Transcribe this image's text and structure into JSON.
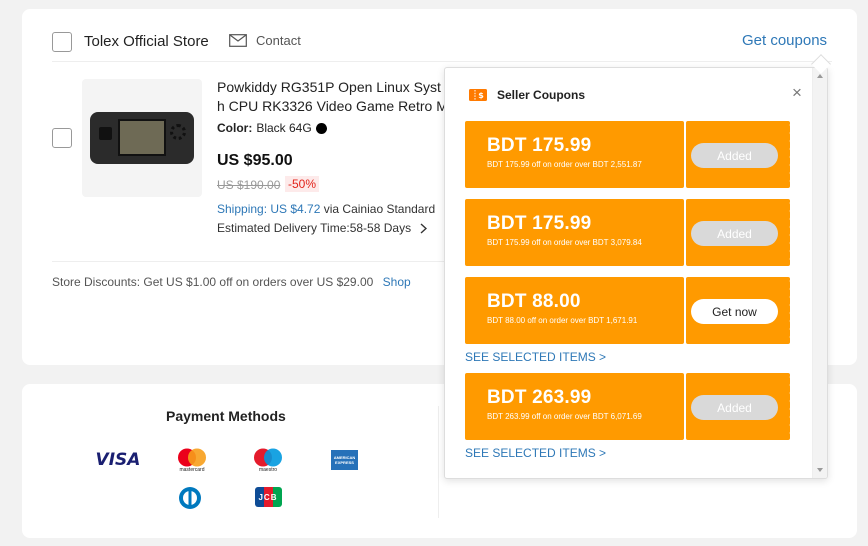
{
  "store": {
    "name": "Tolex Official Store",
    "contact_label": "Contact",
    "get_coupons_label": "Get coupons"
  },
  "product": {
    "title_line1": "Powkiddy RG351P Open Linux Syst",
    "title_line2": "h CPU RK3326 Video Game Retro M",
    "color_label": "Color:",
    "color_value": "Black 64G",
    "price": "US $95.00",
    "old_price": "US $190.00",
    "discount": "-50%",
    "shipping_label": "Shipping: US $4.72",
    "shipping_via": "via Cainiao Standard",
    "delivery": "Estimated Delivery Time:58-58 Days"
  },
  "store_discount": {
    "text": "Store Discounts:  Get US $1.00 off on orders over US $29.00",
    "shop_label": "Shop"
  },
  "payment": {
    "title": "Payment Methods",
    "visa_label": "VISA",
    "mastercard_label": "mastercard",
    "maestro_label": "maestro",
    "amex_label": "AMERICAN EXPRESS",
    "jcb_label": "JCB"
  },
  "coupons_popover": {
    "title": "Seller Coupons",
    "close": "×",
    "coupons": [
      {
        "amount": "BDT 175.99",
        "desc": "BDT 175.99 off on order over BDT 2,551.87",
        "button": "Added",
        "state": "added"
      },
      {
        "amount": "BDT 175.99",
        "desc": "BDT 175.99 off on order over BDT 3,079.84",
        "button": "Added",
        "state": "added"
      },
      {
        "amount": "BDT 88.00",
        "desc": "BDT 88.00 off on order over BDT 1,671.91",
        "button": "Get now",
        "state": "available"
      },
      {
        "amount": "BDT 263.99",
        "desc": "BDT 263.99 off on order over BDT 6,071.69",
        "button": "Added",
        "state": "added"
      }
    ],
    "see_selected_label": "SEE SELECTED ITEMS >"
  },
  "colors": {
    "coupon_orange": "#ff9a00",
    "link_blue": "#2e78b7",
    "discount_red": "#e2231a"
  }
}
